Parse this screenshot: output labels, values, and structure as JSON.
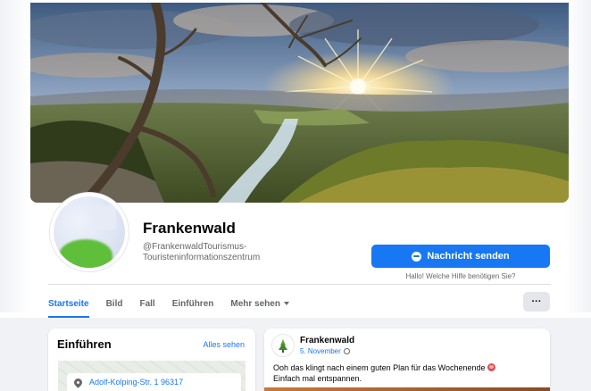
{
  "page": {
    "name": "Frankenwald",
    "handle_line1": "@FrankenwaldTourismus-",
    "handle_line2": "Touristeninformationszentrum"
  },
  "actions": {
    "message_label": "Nachricht senden",
    "message_hint": "Hallo! Welche Hilfe benötigen Sie?",
    "more_label": "···"
  },
  "tabs": [
    {
      "label": "Startseite",
      "active": true
    },
    {
      "label": "Bild",
      "active": false
    },
    {
      "label": "Fall",
      "active": false
    },
    {
      "label": "Einführen",
      "active": false
    },
    {
      "label": "Mehr sehen",
      "active": false
    }
  ],
  "intro": {
    "title": "Einführen",
    "see_all": "Alles sehen",
    "address": "Adolf-Kolping-Str. 1 96317"
  },
  "post": {
    "author": "Frankenwald",
    "date": "5. November",
    "text_line1": "Ooh das klingt nach einem guten Plan für das Wochenende",
    "text_line2": "Einfach mal entspannen."
  },
  "colors": {
    "accent": "#1877f2",
    "background": "#f0f2f5",
    "secondary_text": "#65676b"
  }
}
